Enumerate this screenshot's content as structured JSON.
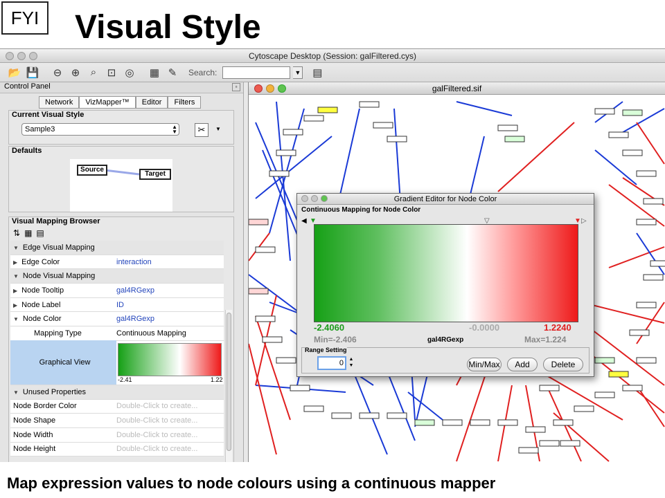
{
  "slide": {
    "tag": "FYI",
    "title": "Visual Style",
    "caption": "Map expression values to node colours using a continuous mapper"
  },
  "app": {
    "window_title": "Cytoscape Desktop (Session: galFiltered.cys)",
    "toolbar": {
      "search_label": "Search:",
      "search_value": "",
      "icons": [
        "open-folder-icon",
        "save-icon",
        "zoom-out-icon",
        "zoom-in-icon",
        "zoom-selected-icon",
        "zoom-fit-icon",
        "help-icon",
        "vizmapper-icon",
        "edit-icon",
        "preferences-icon"
      ]
    }
  },
  "control_panel": {
    "title": "Control Panel",
    "tabs": [
      "Network",
      "VizMapper™",
      "Editor",
      "Filters"
    ],
    "current_style_title": "Current Visual Style",
    "current_style": "Sample3",
    "defaults_title": "Defaults",
    "defaults_source": "Source",
    "defaults_target": "Target",
    "mapping_browser_title": "Visual Mapping Browser",
    "rows": [
      {
        "key": "Edge Visual Mapping",
        "value": "",
        "section": true
      },
      {
        "key": "Edge Color",
        "value": "interaction"
      },
      {
        "key": "Node Visual Mapping",
        "value": "",
        "section": true
      },
      {
        "key": "Node Tooltip",
        "value": "gal4RGexp"
      },
      {
        "key": "Node Label",
        "value": "ID"
      },
      {
        "key": "Node Color",
        "value": "gal4RGexp"
      },
      {
        "key": "Mapping Type",
        "value": "Continuous Mapping"
      }
    ],
    "graphical_view_label": "Graphical View",
    "graphical_min": "-2.41",
    "graphical_max": "1.22",
    "unused_title": "Unused Properties",
    "unused_rows": [
      {
        "key": "Node Border Color",
        "value": "Double-Click to create..."
      },
      {
        "key": "Node Shape",
        "value": "Double-Click to create..."
      },
      {
        "key": "Node Width",
        "value": "Double-Click to create..."
      },
      {
        "key": "Node Height",
        "value": "Double-Click to create..."
      }
    ]
  },
  "network": {
    "title": "galFiltered.sif",
    "edge_colors": {
      "pd": "#1a3ad6",
      "pp": "#e02020"
    }
  },
  "gradient_editor": {
    "title": "Gradient Editor for Node Color",
    "subtitle": "Continuous Mapping for Node Color",
    "min_value": "-2.4060",
    "mid_value": "-0.0000",
    "max_value": "1.2240",
    "min_label": "Min=-2.406",
    "attribute": "gal4RGexp",
    "max_label": "Max=1.224",
    "range_setting": "Range Setting",
    "spinner_value": "0",
    "buttons": {
      "minmax": "Min/Max",
      "add": "Add",
      "delete": "Delete"
    },
    "colors": {
      "low": "#16a016",
      "mid": "#ffffff",
      "high": "#ee1a1a"
    }
  }
}
